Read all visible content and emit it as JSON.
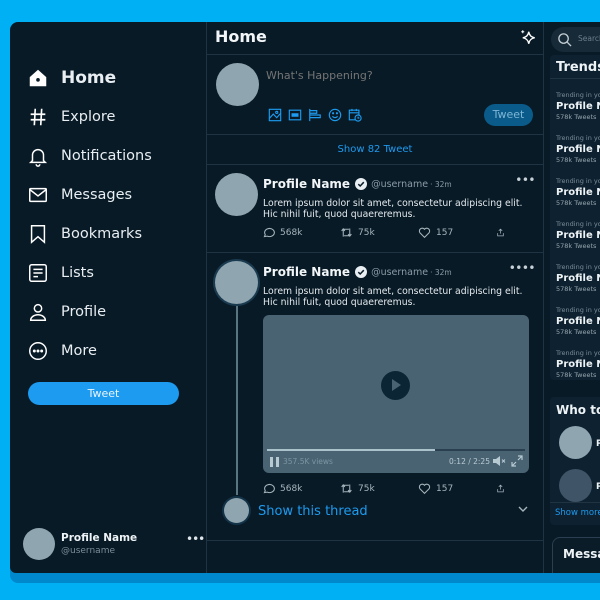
{
  "sidebar": {
    "items": [
      {
        "label": "Home",
        "icon": "home-icon",
        "active": true
      },
      {
        "label": "Explore",
        "icon": "hashtag-icon"
      },
      {
        "label": "Notifications",
        "icon": "bell-icon"
      },
      {
        "label": "Messages",
        "icon": "mail-icon"
      },
      {
        "label": "Bookmarks",
        "icon": "bookmark-icon"
      },
      {
        "label": "Lists",
        "icon": "list-icon"
      },
      {
        "label": "Profile",
        "icon": "user-icon"
      },
      {
        "label": "More",
        "icon": "more-circle-icon"
      }
    ],
    "tweet_button": "Tweet",
    "account": {
      "name": "Profile Name",
      "username": "@username",
      "more": "•••"
    }
  },
  "main": {
    "title": "Home",
    "composer": {
      "placeholder": "What's Happening?",
      "tweet_button": "Tweet",
      "tools": [
        "image-icon",
        "gif-icon",
        "poll-icon",
        "emoji-icon",
        "schedule-icon"
      ]
    },
    "show_more": "Show 82 Tweet",
    "tweets": [
      {
        "name": "Profile Name",
        "handle": "@username",
        "time": "· 32m",
        "more": "•••",
        "text": "Lorem ipsum dolor sit amet, consectetur adipiscing elit. Hic nihil fuit, quod quaereremus.",
        "replies": "568k",
        "retweets": "75k",
        "likes": "157"
      },
      {
        "name": "Profile Name",
        "handle": "@username",
        "time": "· 32m",
        "more": "••••",
        "text": "Lorem ipsum dolor sit amet, consectetur adipiscing elit. Hic nihil fuit, quod quaereremus.",
        "video": {
          "views": "357.5K views",
          "time": "0:12 / 2:25",
          "progress": 0.65
        },
        "replies": "568k",
        "retweets": "75k",
        "likes": "157",
        "thread_link": "Show this thread"
      }
    ]
  },
  "right": {
    "search_placeholder": "Search",
    "trends_title": "Trends",
    "trends": [
      {
        "context": "Trending in your",
        "name": "Profile Name",
        "count": "578k Tweets"
      },
      {
        "context": "Trending in your",
        "name": "Profile Name",
        "count": "578k Tweets"
      },
      {
        "context": "Trending in your",
        "name": "Profile Name",
        "count": "578k Tweets"
      },
      {
        "context": "Trending in your",
        "name": "Profile Name",
        "count": "578k Tweets"
      },
      {
        "context": "Trending in your",
        "name": "Profile Name",
        "count": "578k Tweets"
      },
      {
        "context": "Trending in your",
        "name": "Profile Name",
        "count": "578k Tweets"
      },
      {
        "context": "Trending in your",
        "name": "Profile Name",
        "count": "578k Tweets"
      }
    ],
    "who_title": "Who to follow",
    "who": [
      {
        "color": "#8fa5b0"
      },
      {
        "color": "#3f5466"
      }
    ],
    "show_more": "Show more",
    "messages_title": "Messages"
  },
  "colors": {
    "accent": "#1d9bf0",
    "background": "#081a26",
    "frame": "#00b0f5"
  }
}
